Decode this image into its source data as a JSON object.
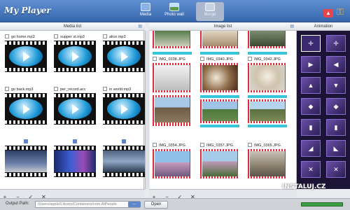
{
  "app": {
    "title": "My Player"
  },
  "toolbar": {
    "media": "Media",
    "photo_wall": "Photo wall",
    "active_tab": "Merge"
  },
  "panels": {
    "media_list": "Media list",
    "image_list": "Image list",
    "animation": "Animation"
  },
  "media": {
    "items": [
      {
        "label": "go home.mp3"
      },
      {
        "label": "supper st.mp3"
      },
      {
        "label": "alice.mp3"
      },
      {
        "label": "go back.mp3"
      },
      {
        "label": "per_record.acc"
      },
      {
        "label": "in world.mp3"
      }
    ]
  },
  "images": {
    "items": [
      {
        "label": "IMG_0338.JPG"
      },
      {
        "label": "IMG_0340.JPG"
      },
      {
        "label": "IMG_0342.JPG"
      },
      {
        "label": "IMG_0354.JPG"
      },
      {
        "label": "IMG_0357.JPG"
      },
      {
        "label": "IMG_0365.JPG"
      }
    ]
  },
  "bottom": {
    "output_label": "Output Path:",
    "output_path": "/Users/apple/Library/Containers/com.AlPeople",
    "browse": "...",
    "open": "Open"
  },
  "watermark": "INSTALUJ.CZ",
  "colors": {
    "accent": "#3667ad",
    "cyan": "#35c7d9",
    "red": "#e02a3b",
    "animation_bg": "#1c1436"
  }
}
